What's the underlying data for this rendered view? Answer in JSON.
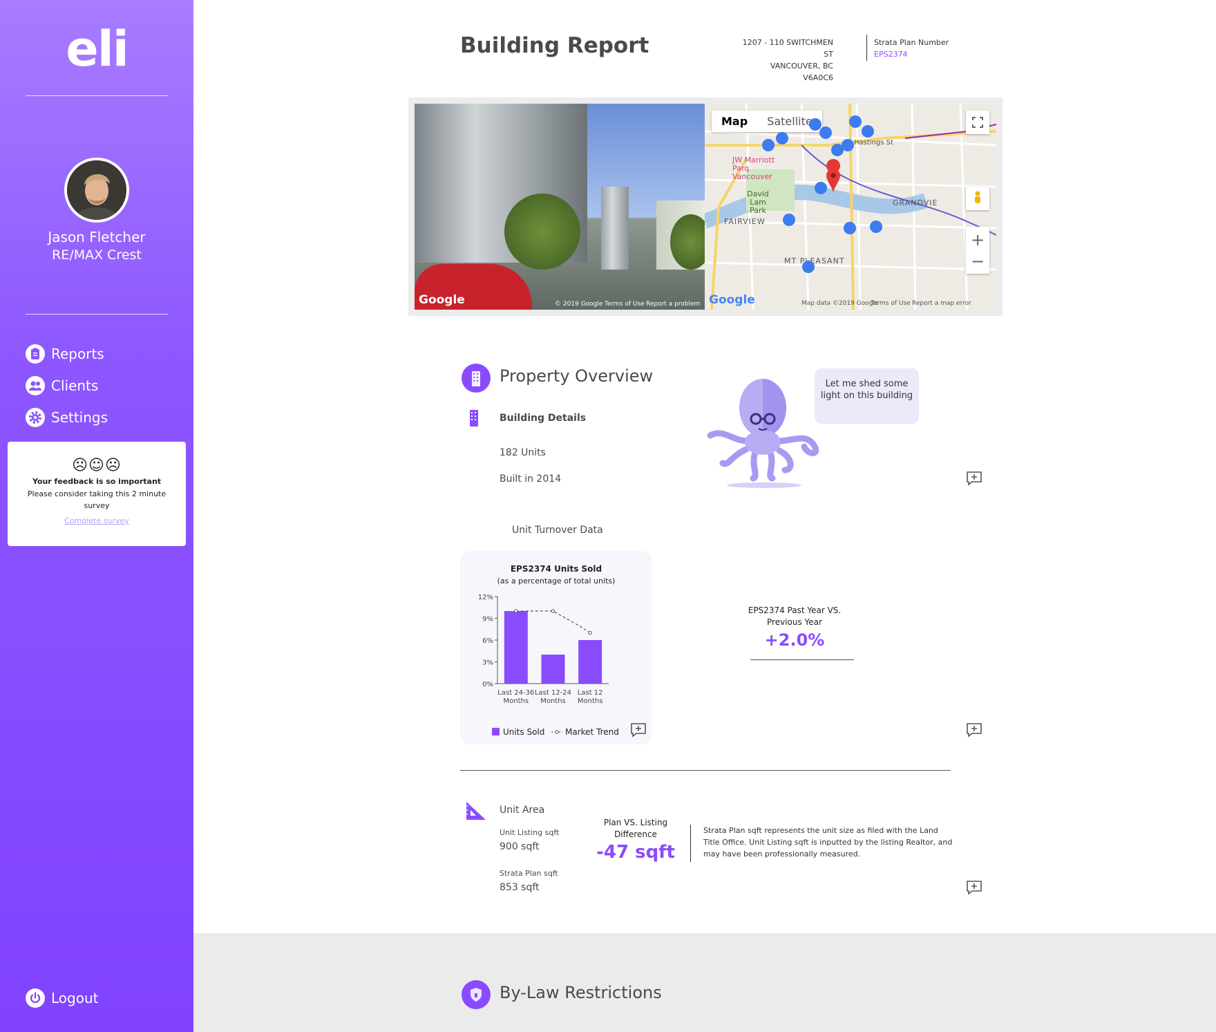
{
  "sidebar": {
    "logo": "eli",
    "user": {
      "name": "Jason Fletcher",
      "org": "RE/MAX Crest"
    },
    "nav": [
      {
        "label": "Reports",
        "icon": "clipboard-icon"
      },
      {
        "label": "Clients",
        "icon": "users-icon"
      },
      {
        "label": "Settings",
        "icon": "gear-icon"
      }
    ],
    "feedback": {
      "faces": "☹☺☹",
      "title": "Your feedback is so important",
      "text": "Please consider taking this 2 minute survey",
      "link": "Complete survey"
    },
    "logout": "Logout"
  },
  "header": {
    "title": "Building Report",
    "address_line1": "1207 - 110 SWITCHMEN ST",
    "address_line2": "VANCOUVER, BC V6A0C6",
    "strata_label": "Strata Plan Number",
    "strata_number": "EPS2374"
  },
  "map": {
    "street_watermark": "Google",
    "street_copyright": "© 2019 Google",
    "street_terms": "Terms of Use",
    "street_report": "Report a problem",
    "tab_map": "Map",
    "tab_satellite": "Satellite",
    "labels": {
      "marriott": "JW Marriott Parq Vancouver",
      "david_lam": "David Lam Park",
      "fairview": "FAIRVIEW",
      "mt_pleasant": "MT PLEASANT",
      "grandview": "GRANDVIE",
      "hastings": "Hastings St"
    },
    "watermark": "Google",
    "map_data": "Map data ©2019 Google",
    "terms": "Terms of Use",
    "report_error": "Report a map error"
  },
  "overview": {
    "title": "Property Overview",
    "building_details": "Building Details",
    "units": "182 Units",
    "built": "Built in 2014",
    "bubble": "Let me shed some light on this building",
    "turnover_title": "Unit Turnover Data"
  },
  "chart_data": {
    "type": "bar",
    "title": "EPS2374 Units Sold",
    "subtitle": "(as a percentage of total units)",
    "categories": [
      "Last 24-36 Months",
      "Last 12-24 Months",
      "Last 12 Months"
    ],
    "category_lines": [
      [
        "Last 24-36",
        "Months"
      ],
      [
        "Last 12-24",
        "Months"
      ],
      [
        "Last 12",
        "Months"
      ]
    ],
    "series": [
      {
        "name": "Units Sold",
        "type": "bar",
        "values": [
          10,
          4,
          6
        ],
        "color": "#8a4bff"
      },
      {
        "name": "Market Trend",
        "type": "line",
        "values": [
          10,
          10,
          7
        ],
        "color": "#555555"
      }
    ],
    "ylim": [
      0,
      12
    ],
    "yticks": [
      "0%",
      "3%",
      "6%",
      "9%",
      "12%"
    ],
    "ytick_values": [
      0,
      3,
      6,
      9,
      12
    ]
  },
  "kpi": {
    "title": "EPS2374 Past Year VS. Previous Year",
    "value": "+2.0%"
  },
  "unit_area": {
    "title": "Unit Area",
    "listing_label": "Unit Listing sqft",
    "listing_value": "900 sqft",
    "strata_label": "Strata Plan sqft",
    "strata_value": "853 sqft",
    "diff_title": "Plan VS. Listing Difference",
    "diff_value": "-47 sqft",
    "note": "Strata Plan sqft represents the unit size as filed with the Land Title Office. Unit Listing sqft is inputted by the listing Realtor, and may have been professionally measured."
  },
  "bylaw": {
    "title": "By-Law Restrictions"
  },
  "colors": {
    "accent": "#8a4bff",
    "sidebar": "#8d56ff"
  }
}
